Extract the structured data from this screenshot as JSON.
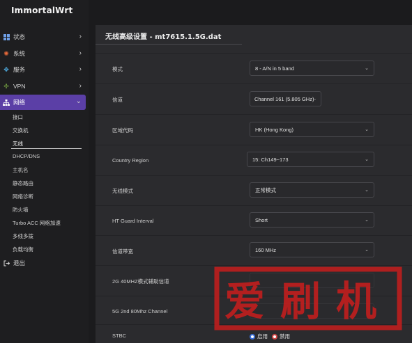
{
  "brand": "ImmortalWrt",
  "sidebar": {
    "items": [
      {
        "label": "状态",
        "icon": "dashboard-icon"
      },
      {
        "label": "系统",
        "icon": "gear-icon"
      },
      {
        "label": "服务",
        "icon": "services-icon"
      },
      {
        "label": "VPN",
        "icon": "vpn-icon"
      },
      {
        "label": "网络",
        "icon": "network-icon",
        "active": true
      },
      {
        "label": "退出",
        "icon": "logout-icon"
      }
    ],
    "network_sub": [
      "接口",
      "交换机",
      "无线",
      "DHCP/DNS",
      "主机名",
      "静态路由",
      "网络诊断",
      "防火墙",
      "Turbo ACC 网络加速",
      "多线多拨",
      "负载均衡"
    ],
    "active_sub": "无线"
  },
  "panel": {
    "title": "无线高级设置 - mt7615.1.5G.dat",
    "rows": [
      {
        "label": "模式",
        "value": "8 - A/N in 5 band"
      },
      {
        "label": "信道",
        "value": "Channel 161 (5.805 GHz)-"
      },
      {
        "label": "区域代码",
        "value": "HK (Hong Kong)"
      },
      {
        "label": "Country Region",
        "value": "15: Ch149~173"
      },
      {
        "label": "无线模式",
        "value": "正常模式"
      },
      {
        "label": "HT Guard Interval",
        "value": "Short"
      },
      {
        "label": "信道带宽",
        "value": "160 MHz"
      },
      {
        "label": "2G 40MHZ模式辅助信道",
        "value": ""
      },
      {
        "label": "5G 2nd 80Mhz Channel",
        "value": ""
      },
      {
        "label": "STBC",
        "value": ""
      }
    ],
    "stbc": {
      "enable_label": "启用",
      "disable_label": "禁用"
    }
  },
  "watermark": "爱刷机",
  "colors": {
    "accent": "#5b3fa6",
    "stamp": "#c21e1e"
  }
}
